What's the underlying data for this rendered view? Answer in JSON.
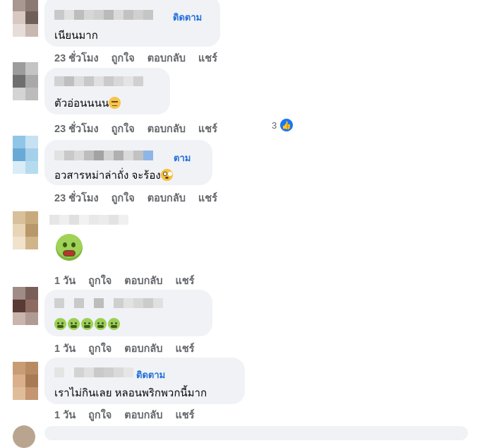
{
  "comments": [
    {
      "follow": "ติดตาม",
      "text": "เนียนมาก",
      "actions": [
        "23 ชั่วโมง",
        "ถูกใจ",
        "ตอบกลับ",
        "แชร์"
      ]
    },
    {
      "follow": "",
      "text": "ตัวอ่อนนนน",
      "emoji": "neutral-face-icon",
      "actions": [
        "23 ชั่วโมง",
        "ถูกใจ",
        "ตอบกลับ",
        "แชร์"
      ],
      "reaction_count": "3"
    },
    {
      "follow": "ตาม",
      "text": "อวสารหม่าล่าถั่ง จะร้อง",
      "emoji": "flushed-face-icon",
      "actions": [
        "23 ชั่วโมง",
        "ถูกใจ",
        "ตอบกลับ",
        "แชร์"
      ]
    },
    {
      "sticker": "nauseated-face-icon",
      "actions": [
        "1 วัน",
        "ถูกใจ",
        "ตอบกลับ",
        "แชร์"
      ]
    },
    {
      "emoji": "nauseated-face-icon",
      "emoji_count": 5,
      "actions": [
        "1 วัน",
        "ถูกใจ",
        "ตอบกลับ",
        "แชร์"
      ]
    },
    {
      "follow": "ติดตาม",
      "text": "เราไม่กินเลย หลอนพริกพวกนี้มาก",
      "actions": [
        "1 วัน",
        "ถูกใจ",
        "ตอบกลับ",
        "แชร์"
      ]
    }
  ],
  "colors": {
    "bubble": "#f0f2f5",
    "link": "#216fdb",
    "muted": "#65676b",
    "like": "#1877f2"
  }
}
